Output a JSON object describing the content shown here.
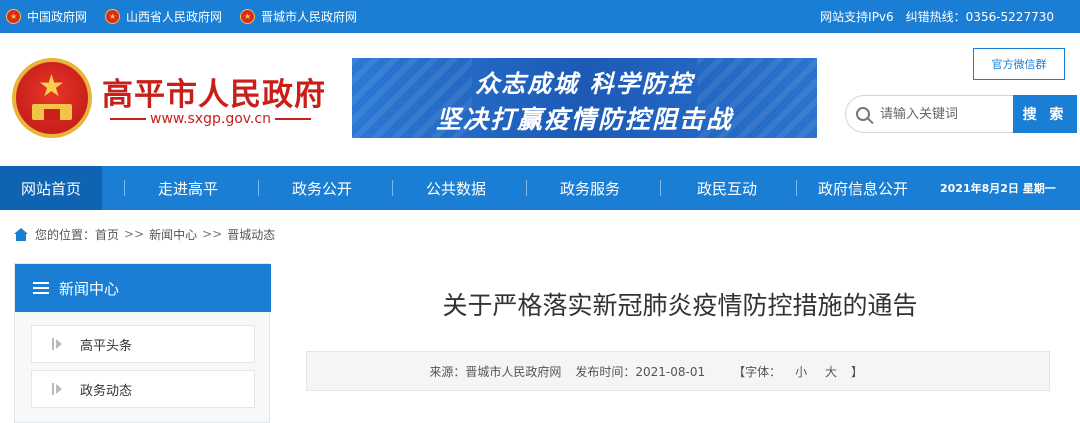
{
  "topbar": {
    "links": [
      "中国政府网",
      "山西省人民政府网",
      "晋城市人民政府网"
    ],
    "ipv6": "网站支持IPv6",
    "report": "纠错热线：0356-5227730"
  },
  "header": {
    "site_title": "高平市人民政府",
    "site_url": "www.sxgp.gov.cn",
    "banner_line1": "众志成城  科学防控",
    "banner_line2": "坚决打赢疫情防控阻击战",
    "wechat": "官方微信群",
    "search_placeholder": "请输入关键词",
    "search_button": "搜 索"
  },
  "nav": {
    "items": [
      "网站首页",
      "走进高平",
      "政务公开",
      "公共数据",
      "政务服务",
      "政民互动",
      "政府信息公开"
    ],
    "active": "网站首页",
    "date": "2021年8月2日 星期一"
  },
  "breadcrumb": {
    "prefix": "您的位置：",
    "items": [
      "首页",
      "新闻中心",
      "晋城动态"
    ],
    "separator": ">>"
  },
  "sidebar": {
    "title": "新闻中心",
    "items": [
      "高平头条",
      "政务动态"
    ]
  },
  "article": {
    "title": "关于严格落实新冠肺炎疫情防控措施的通告",
    "source": "来源：晋城市人民政府网",
    "publish": "发布时间：2021-08-01",
    "font_prefix": "【字体：",
    "font_small": "小",
    "font_large": "大",
    "font_suffix": "】"
  },
  "colors": {
    "primary": "#1a7fd4",
    "brand_red": "#c81f19"
  }
}
